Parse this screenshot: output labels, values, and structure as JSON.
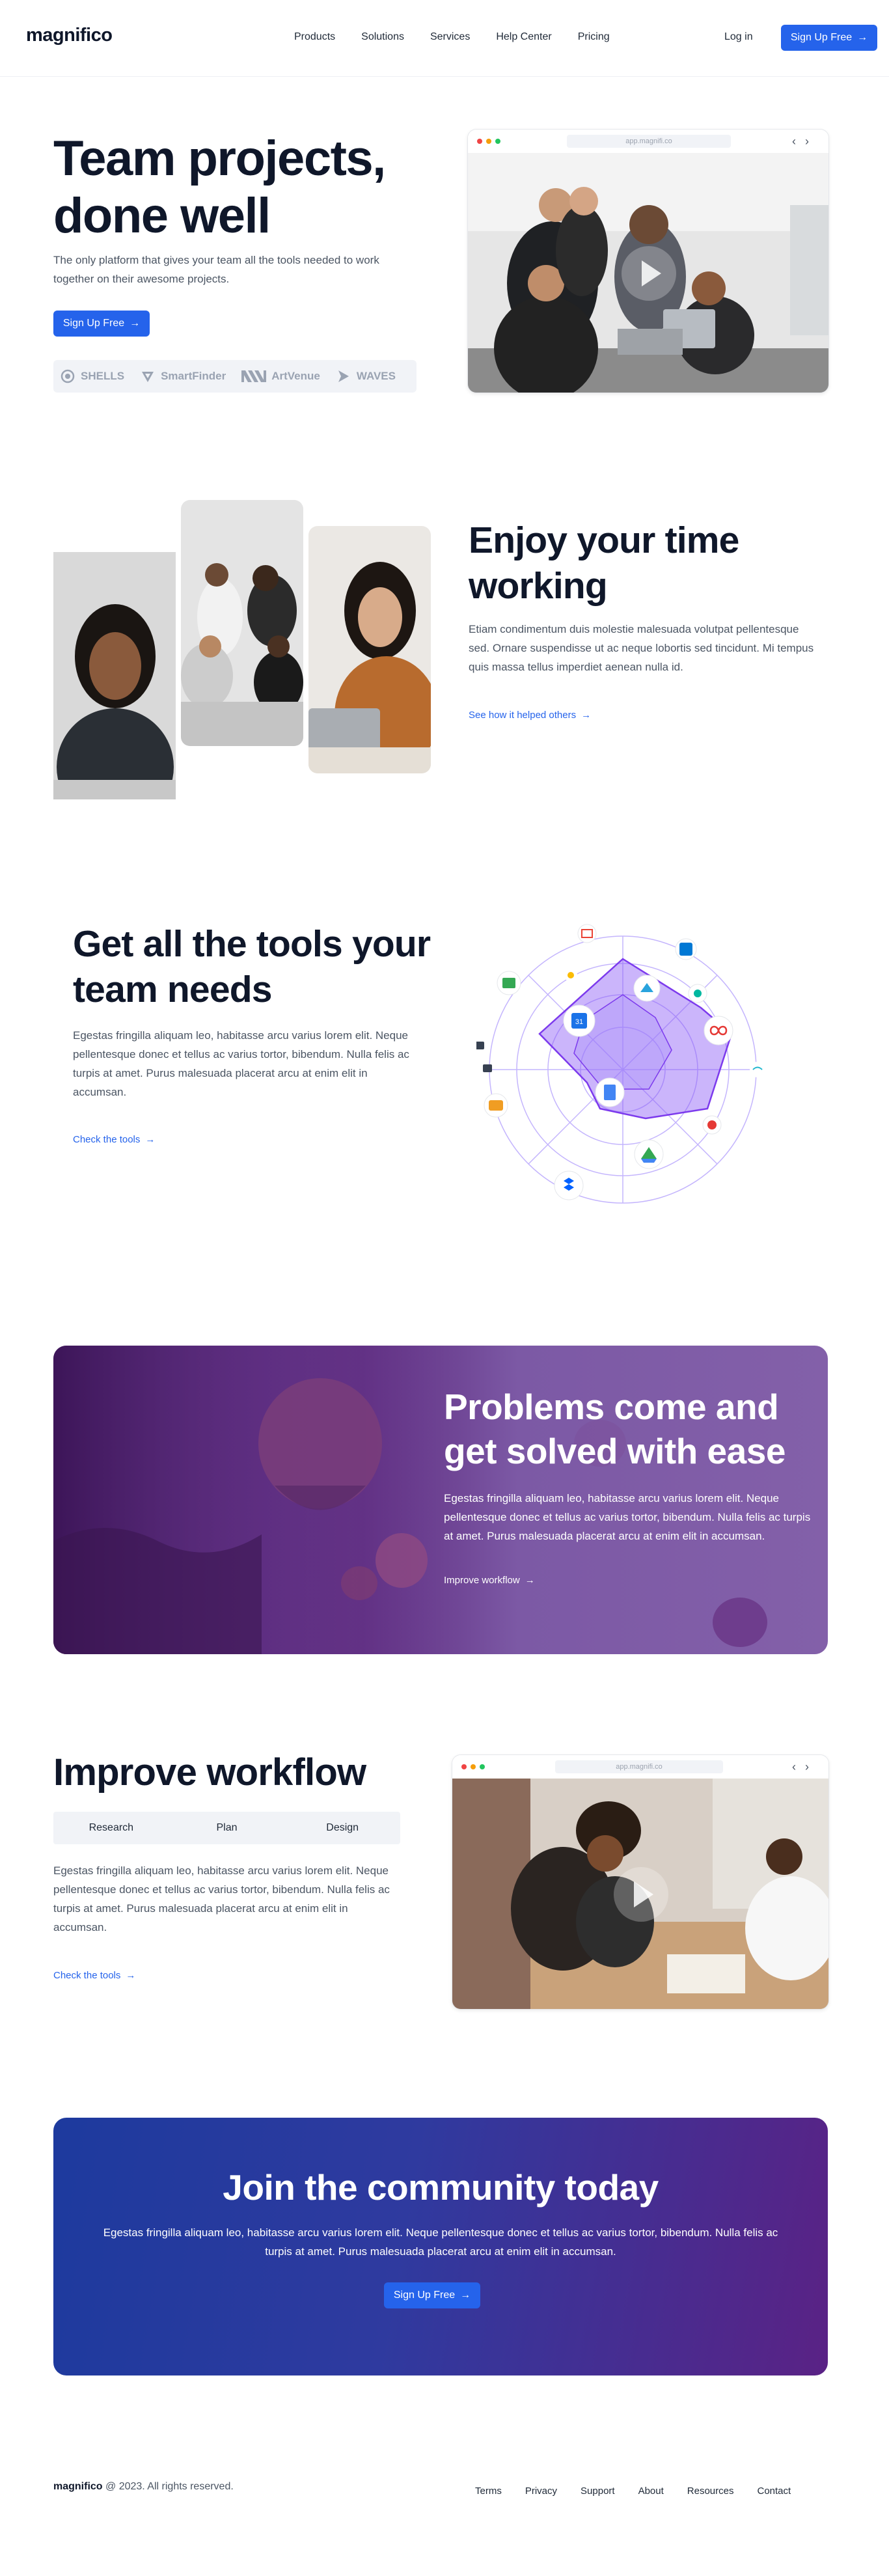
{
  "header": {
    "logo": "magnifico",
    "nav": [
      "Products",
      "Solutions",
      "Services",
      "Help Center",
      "Pricing"
    ],
    "login": "Log in",
    "signup": "Sign Up Free"
  },
  "hero": {
    "title_line1": "Team projects,",
    "title_line2": "done well",
    "subtitle": "The only platform that gives your team all the tools needed to work together on their awesome projects.",
    "cta": "Sign Up Free",
    "partners": [
      "SHELLS",
      "SmartFinder",
      "ArtVenue",
      "WAVES"
    ],
    "browser_url": "app.magnifi.co"
  },
  "enjoy": {
    "title": "Enjoy your time working",
    "text": "Etiam condimentum duis molestie malesuada volutpat pellentesque sed. Ornare suspendisse ut ac neque lobortis sed tincidunt. Mi tempus quis massa tellus imperdiet aenean nulla id.",
    "link": "See how it helped others"
  },
  "tools": {
    "title": "Get all the tools your team needs",
    "text": "Egestas fringilla aliquam leo, habitasse arcu varius lorem elit. Neque pellentesque donec et tellus ac varius tortor, bibendum. Nulla felis ac turpis at amet. Purus malesuada placerat arcu at enim elit in accumsan.",
    "link": "Check the tools"
  },
  "problems": {
    "title": "Problems come and get solved with ease",
    "text": "Egestas fringilla aliquam leo, habitasse arcu varius lorem elit. Neque pellentesque donec et tellus ac varius tortor, bibendum. Nulla felis ac turpis at amet. Purus malesuada placerat arcu at enim elit in accumsan.",
    "link": "Improve workflow"
  },
  "improve": {
    "title": "Improve workflow",
    "tabs": [
      "Research",
      "Plan",
      "Design"
    ],
    "text": "Egestas fringilla aliquam leo, habitasse arcu varius lorem elit. Neque pellentesque donec et tellus ac varius tortor, bibendum. Nulla felis ac turpis at amet. Purus malesuada placerat arcu at enim elit in accumsan.",
    "link": "Check the tools",
    "browser_url": "app.magnifi.co"
  },
  "community": {
    "title": "Join the community today",
    "text": "Egestas fringilla aliquam leo, habitasse arcu varius lorem elit. Neque pellentesque donec et tellus ac varius tortor, bibendum. Nulla felis ac turpis at amet. Purus malesuada placerat arcu at enim elit in accumsan.",
    "cta": "Sign Up Free"
  },
  "footer": {
    "brand": "magnifico",
    "copyright": "@ 2023. All rights reserved.",
    "links": [
      "Terms",
      "Privacy",
      "Support",
      "About",
      "Resources",
      "Contact"
    ]
  },
  "colors": {
    "accent": "#2563eb",
    "heading": "#0f172a",
    "body_text": "#4b5563",
    "radar_purple": "#7c3aed"
  }
}
